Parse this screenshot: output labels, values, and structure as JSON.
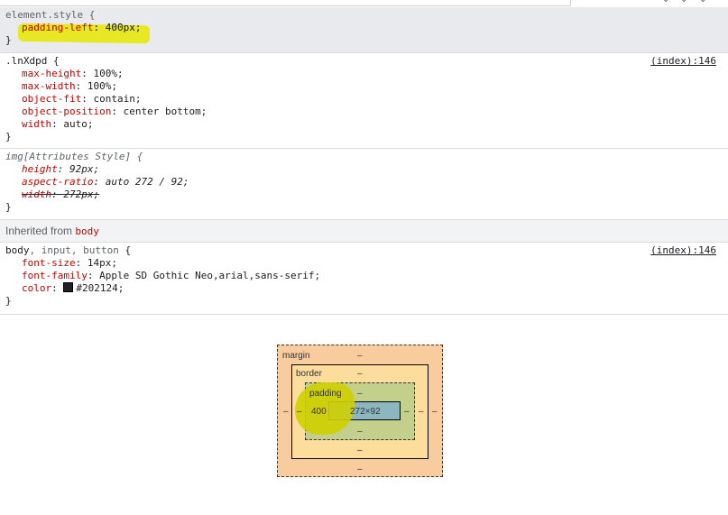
{
  "toolbar": {
    "icons": [
      "new-style-rule-icon",
      "element-state-icon",
      "toggle-classes-icon"
    ]
  },
  "rules": {
    "element_style": {
      "selector": "element.style {",
      "decls": [
        {
          "prop": "padding-left",
          "value": "400px;"
        }
      ],
      "close": "}"
    },
    "lnx": {
      "selector": ".lnXdpd {",
      "source": "(index):146",
      "decls": [
        {
          "prop": "max-height",
          "value": "100%;"
        },
        {
          "prop": "max-width",
          "value": "100%;"
        },
        {
          "prop": "object-fit",
          "value": "contain;"
        },
        {
          "prop": "object-position",
          "value": "center bottom;"
        },
        {
          "prop": "width",
          "value": "auto;"
        }
      ],
      "close": "}"
    },
    "img_attr": {
      "selector": "img[Attributes Style] {",
      "decls": [
        {
          "prop": "height",
          "value": "92px;"
        },
        {
          "prop": "aspect-ratio",
          "value": "auto 272 / 92;"
        },
        {
          "prop": "width",
          "value": "272px;"
        }
      ],
      "close": "}"
    },
    "inherited": {
      "label": "Inherited from",
      "tag": "body"
    },
    "body": {
      "selector_main": "body",
      "selector_rest": ", input, button",
      "selector_open": " {",
      "source": "(index):146",
      "decls": [
        {
          "prop": "font-size",
          "value": "14px;"
        },
        {
          "prop": "font-family",
          "value": "Apple SD Gothic Neo,arial,sans-serif;"
        },
        {
          "prop": "color",
          "value": "#202124;"
        }
      ],
      "close": "}"
    }
  },
  "box_model": {
    "margin_label": "margin",
    "border_label": "border",
    "padding_label": "padding",
    "dash": "–",
    "padding_left": "400",
    "content": "272×92"
  },
  "colors": {
    "highlight": "#e6e600",
    "margin": "#f9cc9d",
    "border": "#fddd9b",
    "padding": "#c3d08b",
    "content": "#8cb6c0",
    "property": "#c80000"
  }
}
